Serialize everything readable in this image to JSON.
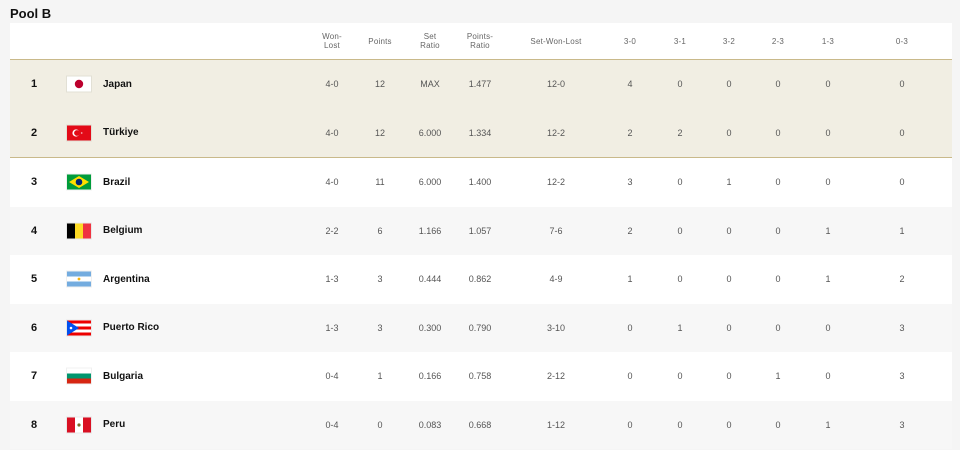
{
  "pool_title": "Pool B",
  "headers": {
    "won_lost": [
      "Won-",
      "Lost"
    ],
    "points": "Points",
    "set_ratio": [
      "Set",
      "Ratio"
    ],
    "points_ratio": [
      "Points-",
      "Ratio"
    ],
    "set_won_lost": "Set-Won-Lost",
    "r30": "3-0",
    "r31": "3-1",
    "r32": "3-2",
    "r23": "2-3",
    "r13": "1-3",
    "r03": "0-3"
  },
  "rows": [
    {
      "rank": "1",
      "team": "Japan",
      "flag": "japan-flag",
      "won_lost": "4-0",
      "points": "12",
      "set_ratio": "MAX",
      "points_ratio": "1.477",
      "set_won_lost": "12-0",
      "r30": "4",
      "r31": "0",
      "r32": "0",
      "r23": "0",
      "r13": "0",
      "r03": "0"
    },
    {
      "rank": "2",
      "team": "Türkiye",
      "flag": "turkiye-flag",
      "won_lost": "4-0",
      "points": "12",
      "set_ratio": "6.000",
      "points_ratio": "1.334",
      "set_won_lost": "12-2",
      "r30": "2",
      "r31": "2",
      "r32": "0",
      "r23": "0",
      "r13": "0",
      "r03": "0"
    },
    {
      "rank": "3",
      "team": "Brazil",
      "flag": "brazil-flag",
      "won_lost": "4-0",
      "points": "11",
      "set_ratio": "6.000",
      "points_ratio": "1.400",
      "set_won_lost": "12-2",
      "r30": "3",
      "r31": "0",
      "r32": "1",
      "r23": "0",
      "r13": "0",
      "r03": "0"
    },
    {
      "rank": "4",
      "team": "Belgium",
      "flag": "belgium-flag",
      "won_lost": "2-2",
      "points": "6",
      "set_ratio": "1.166",
      "points_ratio": "1.057",
      "set_won_lost": "7-6",
      "r30": "2",
      "r31": "0",
      "r32": "0",
      "r23": "0",
      "r13": "1",
      "r03": "1"
    },
    {
      "rank": "5",
      "team": "Argentina",
      "flag": "argentina-flag",
      "won_lost": "1-3",
      "points": "3",
      "set_ratio": "0.444",
      "points_ratio": "0.862",
      "set_won_lost": "4-9",
      "r30": "1",
      "r31": "0",
      "r32": "0",
      "r23": "0",
      "r13": "1",
      "r03": "2"
    },
    {
      "rank": "6",
      "team": "Puerto Rico",
      "flag": "puerto-rico-flag",
      "won_lost": "1-3",
      "points": "3",
      "set_ratio": "0.300",
      "points_ratio": "0.790",
      "set_won_lost": "3-10",
      "r30": "0",
      "r31": "1",
      "r32": "0",
      "r23": "0",
      "r13": "0",
      "r03": "3"
    },
    {
      "rank": "7",
      "team": "Bulgaria",
      "flag": "bulgaria-flag",
      "won_lost": "0-4",
      "points": "1",
      "set_ratio": "0.166",
      "points_ratio": "0.758",
      "set_won_lost": "2-12",
      "r30": "0",
      "r31": "0",
      "r32": "0",
      "r23": "1",
      "r13": "0",
      "r03": "3"
    },
    {
      "rank": "8",
      "team": "Peru",
      "flag": "peru-flag",
      "won_lost": "0-4",
      "points": "0",
      "set_ratio": "0.083",
      "points_ratio": "0.668",
      "set_won_lost": "1-12",
      "r30": "0",
      "r31": "0",
      "r32": "0",
      "r23": "0",
      "r13": "1",
      "r03": "3"
    }
  ],
  "colors": {
    "qualified_bg": "#f1eee3",
    "qualified_border": "#c9b98a",
    "row_bg": "#ffffff",
    "row_alt_bg": "#f7f7f7"
  }
}
